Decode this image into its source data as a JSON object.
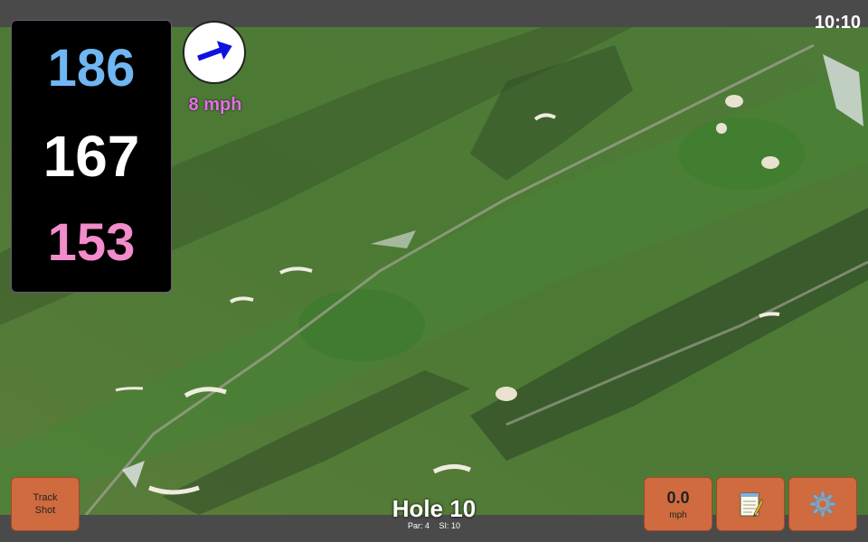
{
  "status_bar": {
    "time": "10:10"
  },
  "distances": {
    "back": "186",
    "middle": "167",
    "front": "153",
    "colors": {
      "back": "#6fb6f2",
      "middle": "#ffffff",
      "front": "#f28ccb"
    }
  },
  "wind": {
    "speed_label": "8 mph",
    "direction_icon": "arrow-right-icon",
    "arrow_color": "#1010e0",
    "label_color": "#e46fe8"
  },
  "track_shot": {
    "line1": "Track",
    "line2": "Shot"
  },
  "hole": {
    "title": "Hole 10",
    "par_label": "Par: 4",
    "si_label": "SI: 10"
  },
  "speed": {
    "value": "0.0",
    "unit": "mph"
  },
  "notes": {
    "icon": "notepad-icon"
  },
  "settings": {
    "icon": "gear-icon"
  },
  "colors": {
    "button_bg": "#cf6b3f",
    "bar_bg": "#4a4a4a"
  }
}
